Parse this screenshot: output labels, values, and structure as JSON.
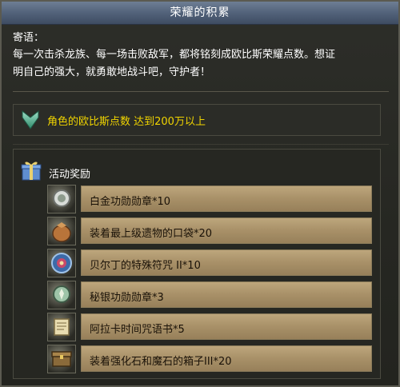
{
  "title": "荣耀的积累",
  "motto": {
    "label": "寄语：",
    "line1": "每一次击杀龙族、每一场击败敌军，都将铭刻成欧比斯荣耀点数。想证",
    "line2": "明自己的强大，就勇敢地战斗吧，守护者！"
  },
  "condition": {
    "icon": "green-chevron-icon",
    "text": "角色的欧比斯点数 达到200万以上"
  },
  "rewards": {
    "header_icon": "gift-box-icon",
    "header": "活动奖励",
    "items": [
      {
        "icon": "platinum-medal-icon",
        "label": "白金功勋勋章*10"
      },
      {
        "icon": "relic-pouch-icon",
        "label": "装着最上级遗物的口袋*20"
      },
      {
        "icon": "talisman-icon",
        "label": "贝尔丁的特殊符咒 II*10"
      },
      {
        "icon": "mithril-medal-icon",
        "label": "秘银功勋勋章*3"
      },
      {
        "icon": "time-scroll-icon",
        "label": "阿拉卡时间咒语书*5"
      },
      {
        "icon": "stone-box-icon",
        "label": "装着强化石和魔石的箱子III*20"
      }
    ]
  },
  "colors": {
    "condition_text": "#f0d400",
    "item_bar": "#a89068",
    "title_bar": "#52627a"
  }
}
